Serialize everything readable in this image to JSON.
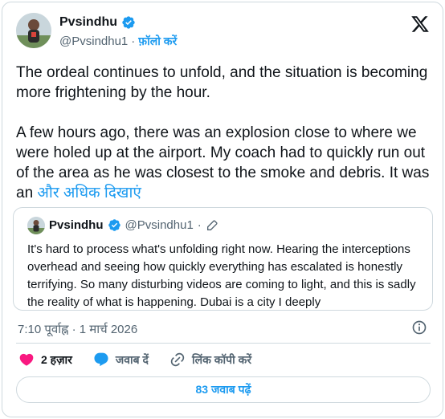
{
  "author": {
    "name": "Pvsindhu",
    "handle": "@Pvsindhu1",
    "separator": "·",
    "follow_label": "फ़ॉलो करें"
  },
  "tweet": {
    "text": "The ordeal continues to unfold, and the situation is becoming more frightening by the hour.\n\nA few hours ago, there was an explosion close to where we were holed up at the airport. My coach had to quickly run out of the area as he was closest to the smoke and debris. It was an ",
    "show_more": "और अधिक दिखाएं"
  },
  "quoted_tweet": {
    "name": "Pvsindhu",
    "handle": "@Pvsindhu1",
    "separator": "·",
    "text": "It's hard to process what's unfolding right now. Hearing the interceptions overhead and seeing how quickly everything has escalated is honestly terrifying. So many disturbing videos are coming to light, and this is sadly the reality of what is happening. Dubai is a city I deeply"
  },
  "timestamp": "7:10 पूर्वाह्न · 1 मार्च 2026",
  "actions": {
    "likes": "2 हज़ार",
    "reply": "जवाब दें",
    "copy_link": "लिंक कॉपी करें"
  },
  "read_replies": "83 जवाब पढ़ें",
  "colors": {
    "accent": "#1d9bf0",
    "verified": "#1d9bf0",
    "like": "#f91880",
    "text": "#0f1419",
    "muted": "#536471"
  },
  "icons": [
    "x-logo-icon",
    "verified-badge-icon",
    "edit-pencil-icon",
    "info-icon",
    "heart-icon",
    "reply-icon",
    "link-icon"
  ]
}
